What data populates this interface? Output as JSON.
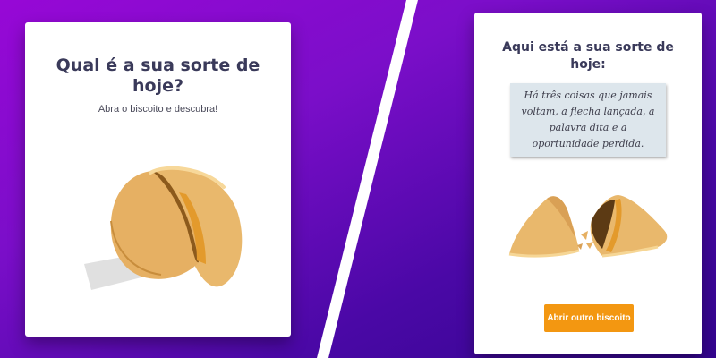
{
  "colors": {
    "background_gradient": [
      "#9708d6",
      "#7b0ec9",
      "#4a08a6",
      "#33058e"
    ],
    "divider": "#ffffff",
    "card": "#ffffff",
    "title": "#3a3a5a",
    "button": "#f39711",
    "fortune_box": "#dde6ec",
    "cookie": "#e8b56a"
  },
  "left_panel": {
    "title": "Qual é a sua sorte de hoje?",
    "subtitle": "Abra o biscoito e descubra!",
    "image_icon": "fortune-cookie-whole"
  },
  "right_panel": {
    "title": "Aqui está a sua sorte de hoje:",
    "fortune": "Há três coisas que jamais voltam, a flecha lançada, a palavra dita e a oportunidade perdida.",
    "image_icon": "fortune-cookie-broken",
    "button_label": "Abrir outro biscoito"
  }
}
